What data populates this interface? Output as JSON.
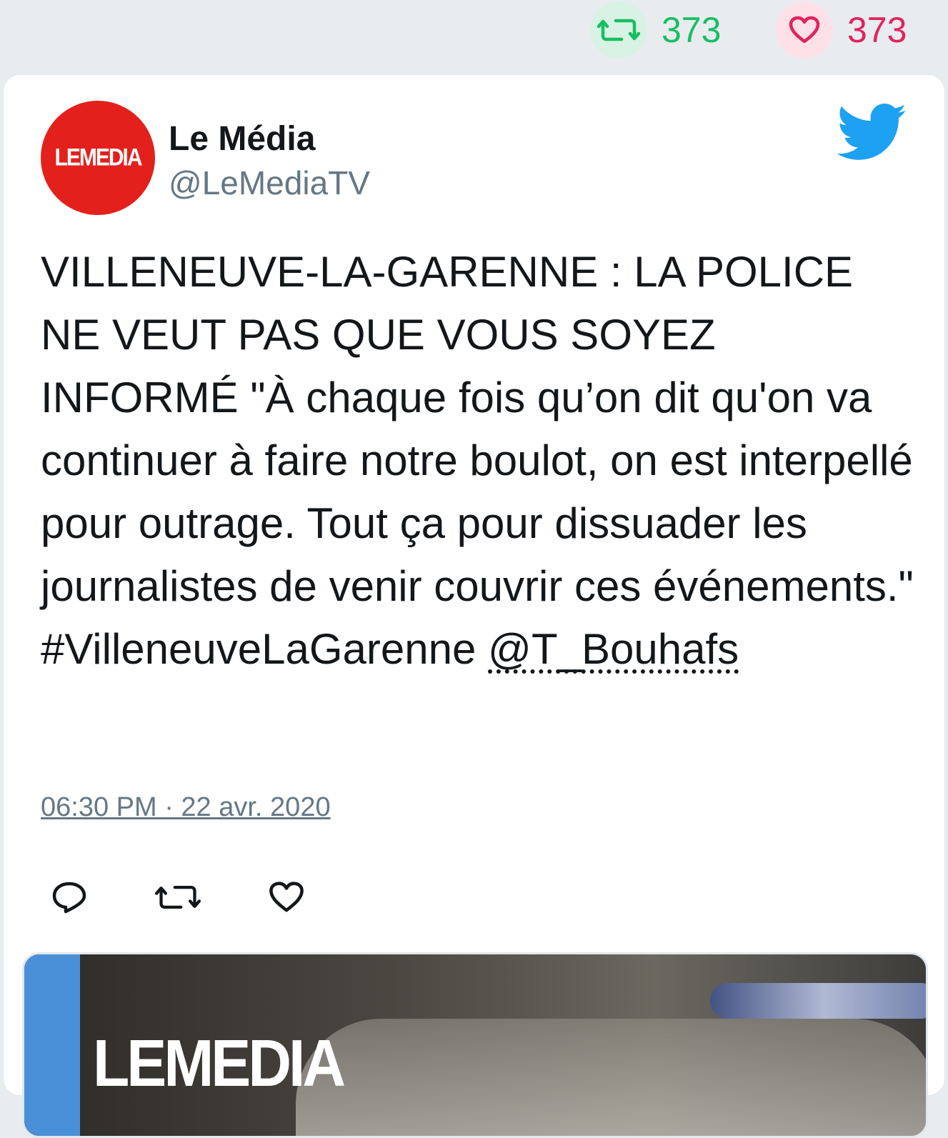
{
  "top_stats": {
    "retweets": {
      "count": "373",
      "icon": "retweet-icon",
      "color": "#17bf63"
    },
    "likes": {
      "count": "373",
      "icon": "heart-icon",
      "color": "#e0245e"
    }
  },
  "tweet": {
    "author": {
      "name": "Le Média",
      "handle": "@LeMediaTV",
      "avatar_text": "LEMEDIA",
      "avatar_color": "#e3201b"
    },
    "text": "VILLENEUVE-LA-GARENNE : LA POLICE NE VEUT PAS QUE VOUS SOYEZ INFORMÉ \"À chaque fois qu’on dit qu'on va continuer à faire notre boulot, on est interpellé pour outrage. Tout ça pour dissuader les journalistes de venir couvrir ces événements.\" #VilleneuveLaGarenne ",
    "mention": "@T_Bouhafs",
    "timestamp": "06:30 PM · 22 avr. 2020",
    "actions": [
      "reply-icon",
      "retweet-icon",
      "like-icon"
    ],
    "media": {
      "logo_text": "LEMEDIA"
    }
  }
}
